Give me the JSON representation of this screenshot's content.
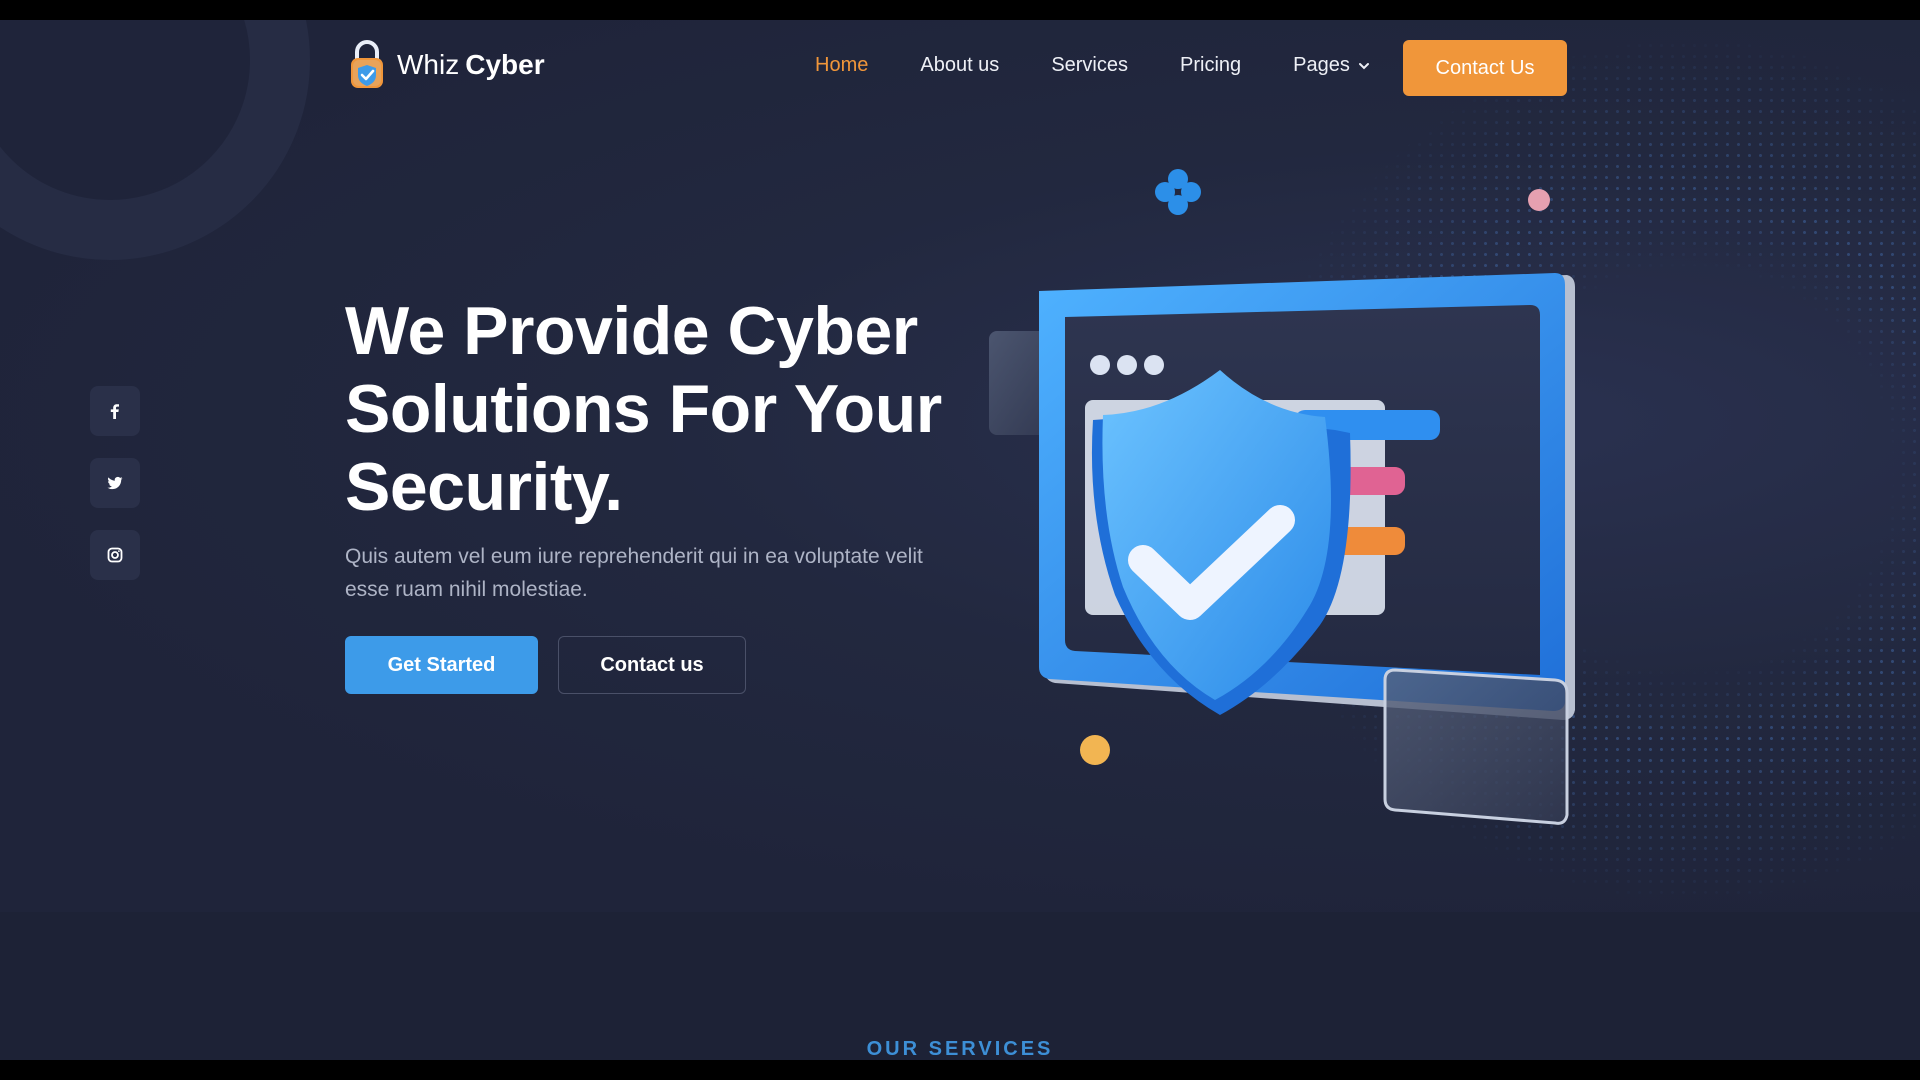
{
  "brand": {
    "name_light": "Whiz",
    "name_bold": "Cyber"
  },
  "nav": {
    "items": [
      {
        "label": "Home"
      },
      {
        "label": "About us"
      },
      {
        "label": "Services"
      },
      {
        "label": "Pricing"
      },
      {
        "label": "Pages"
      }
    ],
    "active": "Home",
    "contact_label": "Contact Us"
  },
  "social": {
    "icons": [
      "facebook-icon",
      "twitter-icon",
      "instagram-icon"
    ]
  },
  "hero": {
    "headline": "We Provide Cyber Solutions For Your Security.",
    "subtext": "Quis autem vel eum iure reprehenderit qui in ea voluptate velit esse ruam nihil molestiae.",
    "primary_label": "Get Started",
    "secondary_label": "Contact us"
  },
  "services": {
    "eyebrow": "OUR SERVICES"
  },
  "colors": {
    "accent_orange": "#f0963a",
    "accent_blue": "#3d9be9",
    "background": "#1d2236"
  }
}
